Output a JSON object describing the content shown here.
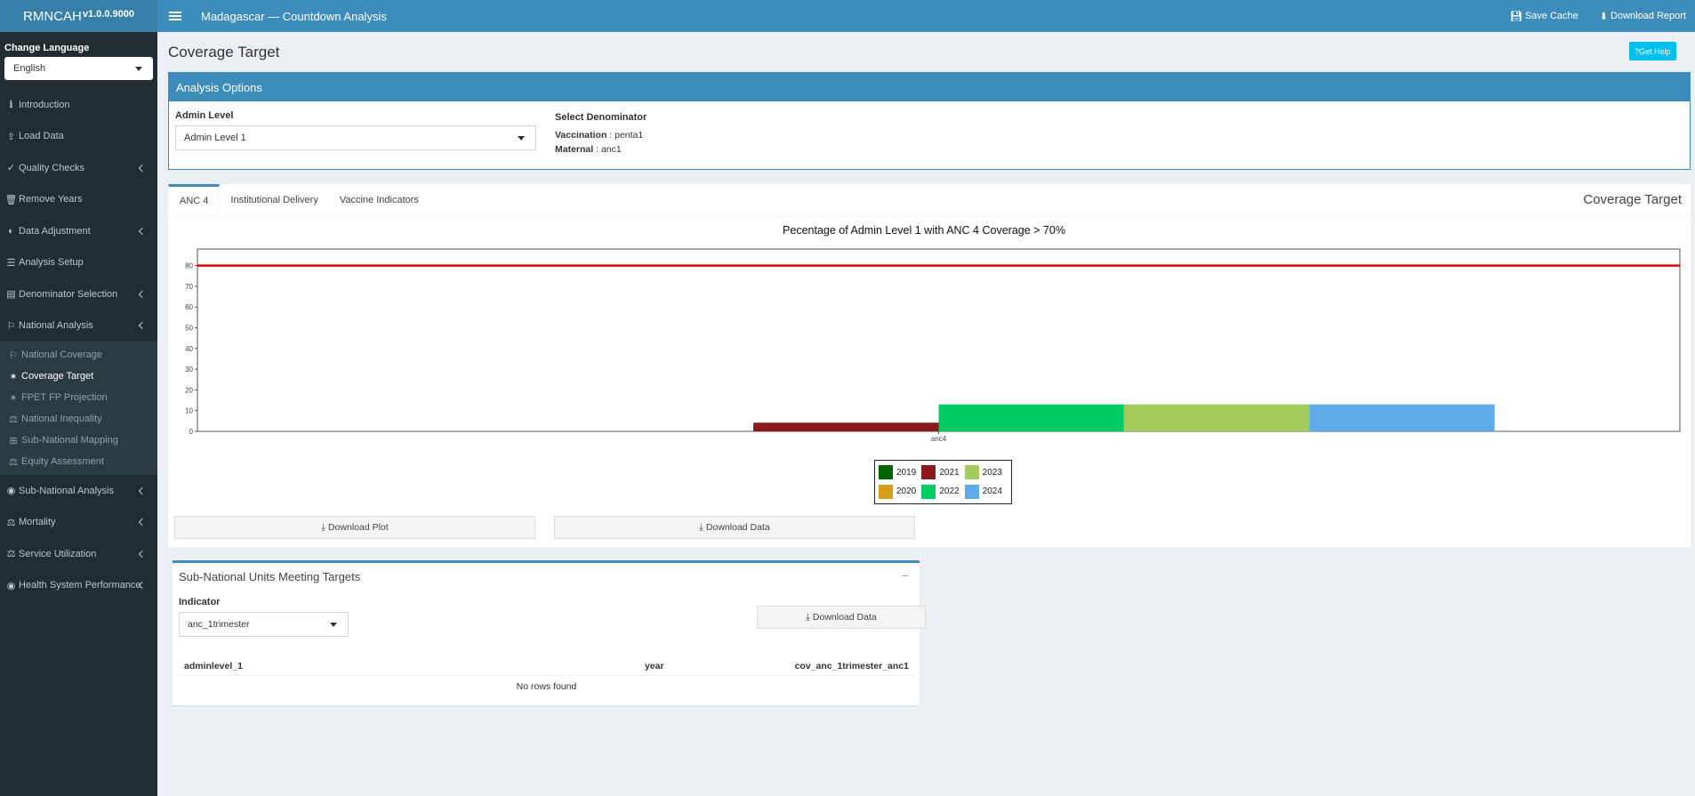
{
  "brand": {
    "name": "RMNCAH",
    "version": "v1.0.0.9000"
  },
  "sidebar": {
    "language_label": "Change Language",
    "language_value": "English",
    "items": [
      {
        "label": "Introduction",
        "icon": "info-icon",
        "glyph": "ℹ"
      },
      {
        "label": "Load Data",
        "icon": "upload-icon",
        "glyph": "⇪"
      },
      {
        "label": "Quality Checks",
        "icon": "check-circle-icon",
        "glyph": "✓"
      },
      {
        "label": "Remove Years",
        "icon": "trash-icon",
        "glyph": "🗑"
      },
      {
        "label": "Data Adjustment",
        "icon": "adjust-icon",
        "glyph": "◐"
      },
      {
        "label": "Analysis Setup",
        "icon": "sliders-icon",
        "glyph": "☰"
      },
      {
        "label": "Denominator Selection",
        "icon": "table-icon",
        "glyph": "▤"
      },
      {
        "label": "National Analysis",
        "icon": "flag-icon",
        "glyph": "⚐"
      }
    ],
    "subitems": [
      {
        "label": "National Coverage",
        "icon": "flag-icon",
        "glyph": "⚐"
      },
      {
        "label": "Coverage Target",
        "icon": "user-icon",
        "glyph": "✶"
      },
      {
        "label": "FPET FP Projection",
        "icon": "user-icon",
        "glyph": "✶"
      },
      {
        "label": "National Inequality",
        "icon": "balance-icon",
        "glyph": "⚖"
      },
      {
        "label": "Sub-National Mapping",
        "icon": "map-icon",
        "glyph": "⊞"
      },
      {
        "label": "Equity Assessment",
        "icon": "balance-icon",
        "glyph": "⚖"
      }
    ],
    "items_after": [
      {
        "label": "Sub-National Analysis",
        "icon": "globe-icon",
        "glyph": "◉"
      },
      {
        "label": "Mortality",
        "icon": "balance-icon",
        "glyph": "⚖"
      },
      {
        "label": "Service Utilization",
        "icon": "balance-icon",
        "glyph": "⚖"
      },
      {
        "label": "Health System Performance",
        "icon": "globe-icon",
        "glyph": "◉"
      }
    ]
  },
  "header": {
    "title": "Madagascar — Countdown Analysis",
    "save_cache": "Save Cache",
    "download_report": "Download Report"
  },
  "page": {
    "title": "Coverage Target",
    "help": "Get Help"
  },
  "options": {
    "title": "Analysis Options",
    "admin_label": "Admin Level",
    "admin_value": "Admin Level 1",
    "denom_label": "Select Denominator",
    "vacc_label": "Vaccination",
    "vacc_value": "penta1",
    "maternal_label": "Maternal",
    "maternal_value": "anc1"
  },
  "tabs": {
    "items": [
      "ANC 4",
      "Institutional Delivery",
      "Vaccine Indicators"
    ],
    "right_title": "Coverage Target"
  },
  "chart_data": {
    "type": "bar",
    "title": "Pecentage of Admin Level 1 with ANC 4 Coverage > 70%",
    "categories": [
      "anc4"
    ],
    "series": [
      {
        "name": "2019",
        "color": "#006400",
        "values": [
          0
        ]
      },
      {
        "name": "2020",
        "color": "#d4a017",
        "values": [
          0
        ]
      },
      {
        "name": "2021",
        "color": "#8b1a1a",
        "values": [
          4.2
        ]
      },
      {
        "name": "2022",
        "color": "#00cc66",
        "values": [
          13
        ]
      },
      {
        "name": "2023",
        "color": "#a3cc5c",
        "values": [
          13
        ]
      },
      {
        "name": "2024",
        "color": "#5eabe8",
        "values": [
          13
        ]
      }
    ],
    "target_line": 80,
    "ylim": [
      0,
      88
    ],
    "yticks": [
      "0",
      "10",
      "20",
      "30",
      "40",
      "50",
      "60",
      "70",
      "80"
    ],
    "legend": "bottom-center"
  },
  "buttons": {
    "download_plot": "Download Plot",
    "download_data": "Download Data"
  },
  "subnational": {
    "title": "Sub-National Units Meeting Targets",
    "collapse": "−",
    "indicator_label": "Indicator",
    "indicator_value": "anc_1trimester",
    "download_data": "Download Data",
    "columns": [
      "adminlevel_1",
      "year",
      "cov_anc_1trimester_anc1"
    ],
    "empty": "No rows found"
  }
}
